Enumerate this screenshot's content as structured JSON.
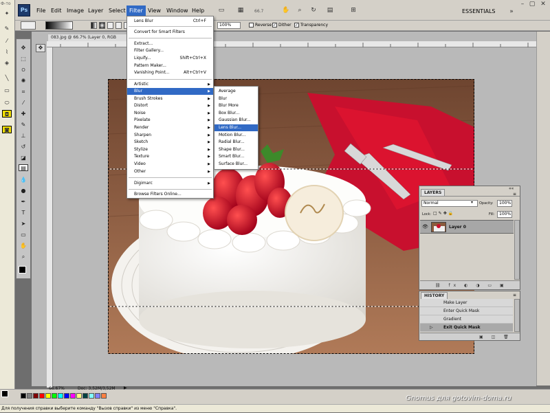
{
  "window": {
    "taskbar_hint": "Ф-то"
  },
  "menubar": {
    "items": [
      "File",
      "Edit",
      "Image",
      "Layer",
      "Select",
      "Filter",
      "View",
      "Window",
      "Help"
    ],
    "active": "Filter",
    "zoom": "66.7",
    "workspace": "ESSENTIALS"
  },
  "options_bar": {
    "opacity": "100%",
    "reverse_label": "Reverse",
    "dither_label": "Dither",
    "transparency_label": "Transparency",
    "reverse_checked": false,
    "dither_checked": true,
    "transparency_checked": true
  },
  "document": {
    "tab_title": "083.jpg @ 66.7% (Layer 0, RGB"
  },
  "filter_menu": {
    "items": [
      {
        "label": "Lens Blur",
        "shortcut": "Ctrl+F"
      },
      {
        "label": "Convert for Smart Filters",
        "shortcut": ""
      },
      {
        "label": "Extract...",
        "shortcut": ""
      },
      {
        "label": "Filter Gallery...",
        "shortcut": ""
      },
      {
        "label": "Liquify...",
        "shortcut": "Shift+Ctrl+X"
      },
      {
        "label": "Pattern Maker...",
        "shortcut": ""
      },
      {
        "label": "Vanishing Point...",
        "shortcut": "Alt+Ctrl+V"
      },
      {
        "label": "Artistic",
        "shortcut": ""
      },
      {
        "label": "Blur",
        "shortcut": ""
      },
      {
        "label": "Brush Strokes",
        "shortcut": ""
      },
      {
        "label": "Distort",
        "shortcut": ""
      },
      {
        "label": "Noise",
        "shortcut": ""
      },
      {
        "label": "Pixelate",
        "shortcut": ""
      },
      {
        "label": "Render",
        "shortcut": ""
      },
      {
        "label": "Sharpen",
        "shortcut": ""
      },
      {
        "label": "Sketch",
        "shortcut": ""
      },
      {
        "label": "Stylize",
        "shortcut": ""
      },
      {
        "label": "Texture",
        "shortcut": ""
      },
      {
        "label": "Video",
        "shortcut": ""
      },
      {
        "label": "Other",
        "shortcut": ""
      },
      {
        "label": "Digimarc",
        "shortcut": ""
      },
      {
        "label": "Browse Filters Online...",
        "shortcut": ""
      }
    ]
  },
  "blur_submenu": {
    "items": [
      "Average",
      "Blur",
      "Blur More",
      "Box Blur...",
      "Gaussian Blur...",
      "Lens Blur...",
      "Motion Blur...",
      "Radial Blur...",
      "Shape Blur...",
      "Smart Blur...",
      "Surface Blur..."
    ],
    "highlighted": "Lens Blur..."
  },
  "layers_panel": {
    "tab": "LAYERS",
    "blend_mode": "Normal",
    "opacity_label": "Opacity:",
    "opacity": "100%",
    "lock_label": "Lock:",
    "fill_label": "Fill:",
    "fill": "100%",
    "layer_name": "Layer 0"
  },
  "history_panel": {
    "tab": "HISTORY",
    "items": [
      "Make Layer",
      "Enter Quick Mask",
      "Gradient",
      "Exit Quick Mask"
    ],
    "selected": "Exit Quick Mask"
  },
  "status": {
    "zoom": "66.67%",
    "doc": "Doc: 3,52M/3,52M",
    "hint": "Для получения справки выберите команду \"Вызов справки\" из меню \"Справка\".",
    "watermark": "Gnomus для gotovim-doma.ru"
  },
  "colors": {
    "menu_highlight": "#316ac5",
    "cake_red": "#c8102e",
    "table_wood": "#8a5a3c"
  }
}
